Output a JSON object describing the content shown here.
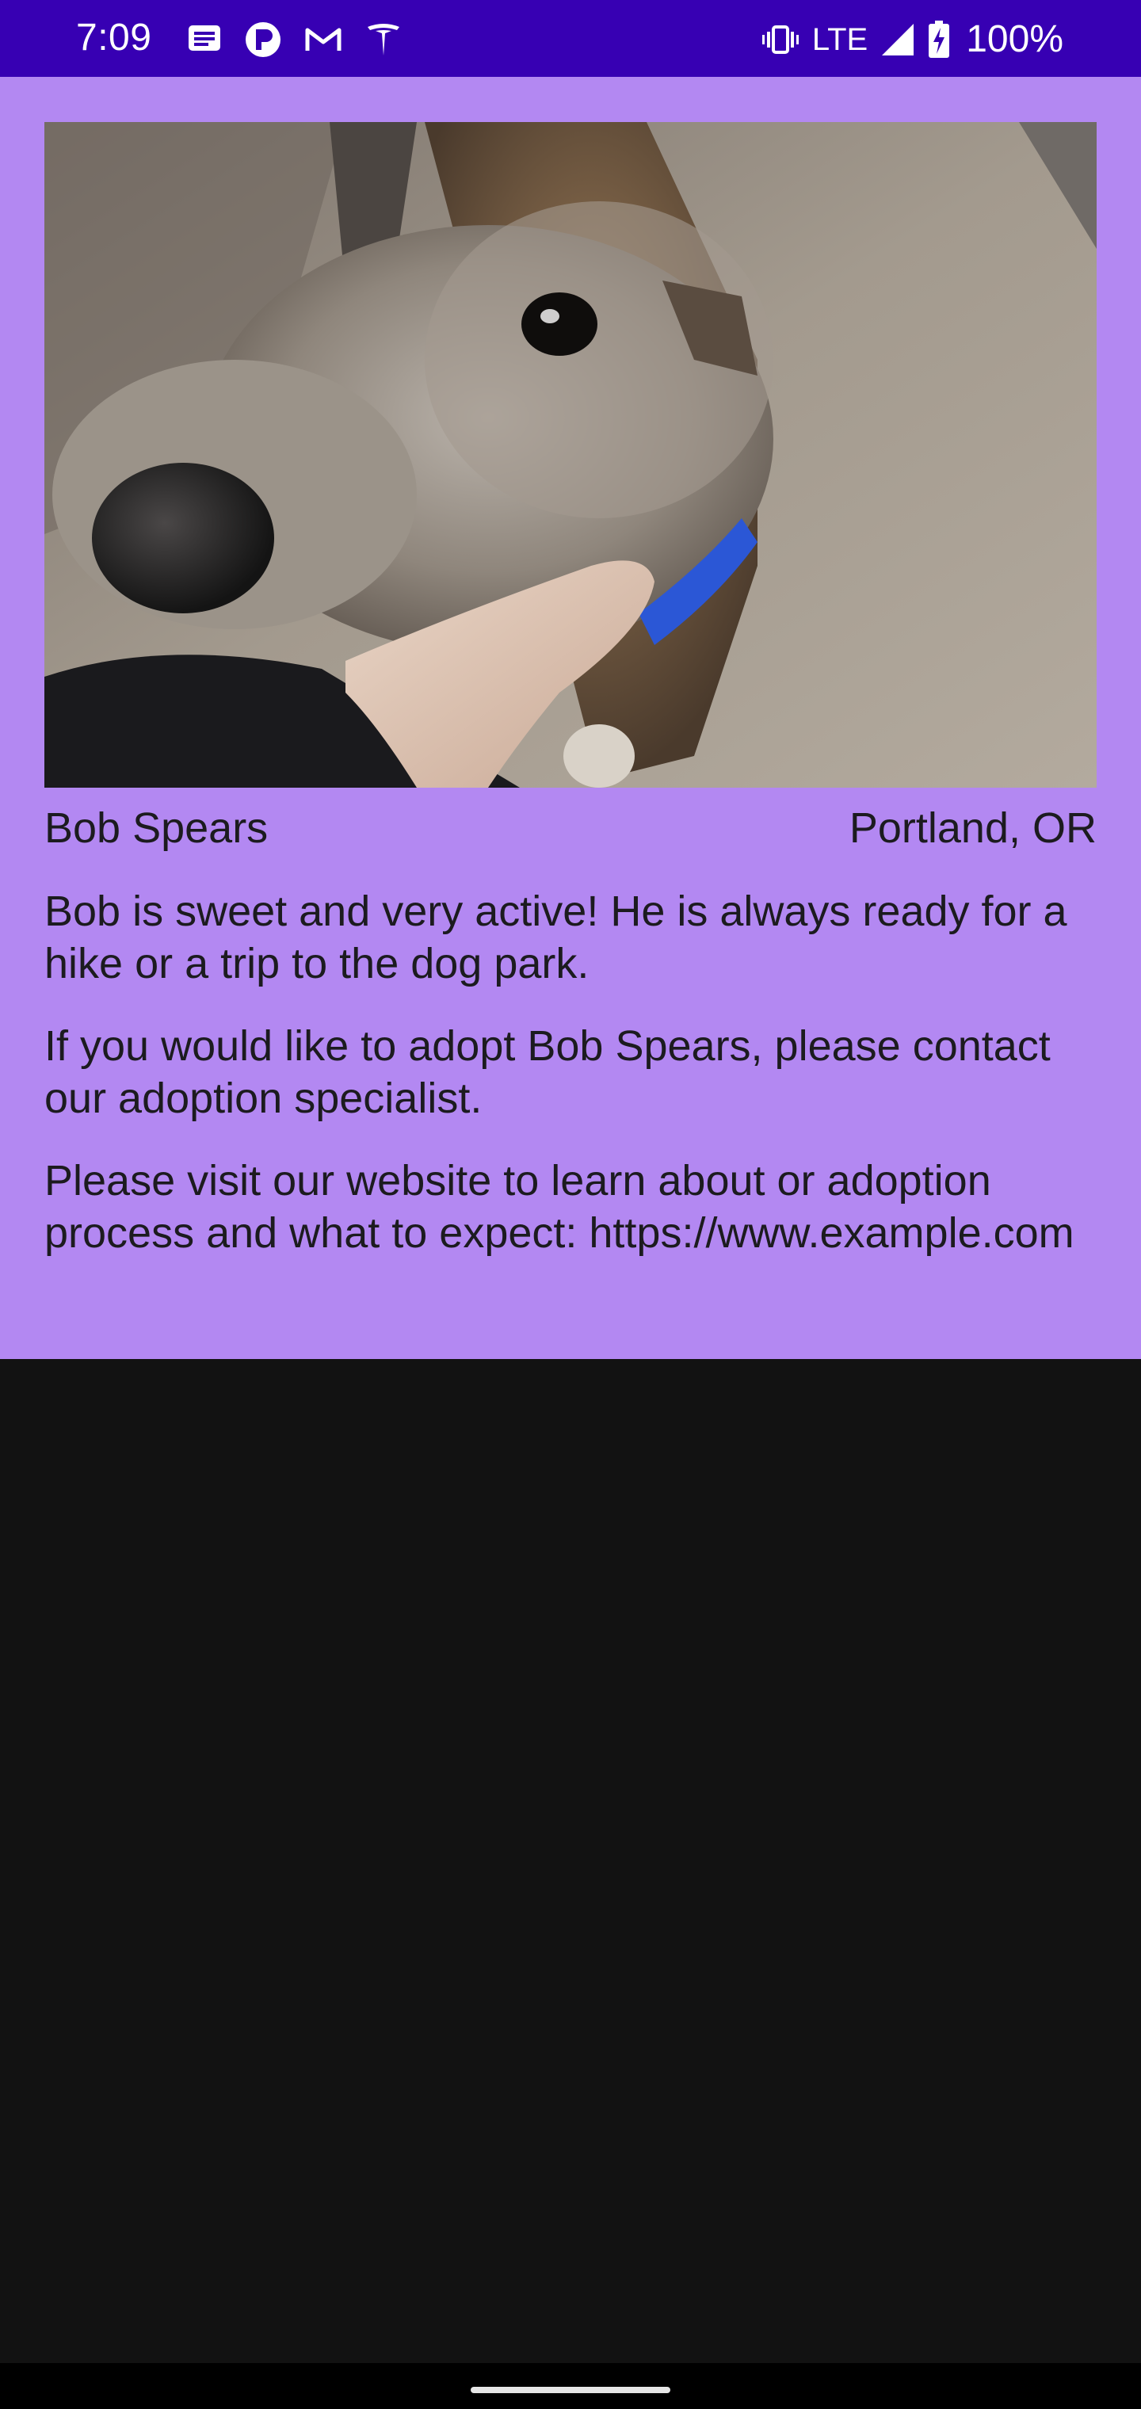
{
  "status_bar": {
    "time": "7:09",
    "left_icons": [
      "messages-icon",
      "app-p-icon",
      "gmail-icon",
      "tesla-icon"
    ],
    "right_icons": [
      "vibrate-icon",
      "signal-icon",
      "battery-charging-icon"
    ],
    "network": "LTE",
    "battery": "100%",
    "background_color": "#3700b3"
  },
  "pet": {
    "photo_alt": "",
    "name": "Bob Spears",
    "location": "Portland, OR",
    "description": "Bob is sweet and very active! He is always ready for a hike or a trip to the dog park.",
    "adopt_message": "If you would like to adopt Bob Spears, please contact our adoption specialist.",
    "website_message": "Please visit our website to learn about or adoption process and what to expect: https://www.example.com"
  },
  "colors": {
    "card_background": "#b388f2",
    "page_background": "#121212",
    "text": "#1c1b1f"
  }
}
